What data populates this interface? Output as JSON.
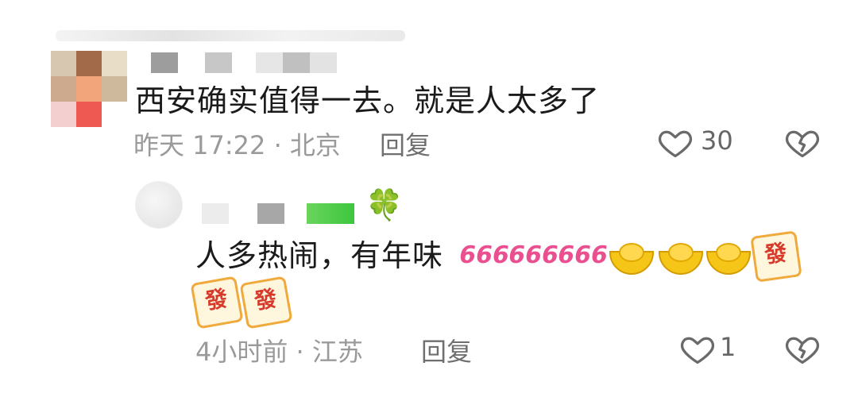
{
  "comments": [
    {
      "text": "西安确实值得一去。就是人太多了",
      "time": "昨天 17:22",
      "location": "北京",
      "reply_label": "回复",
      "likes": "30"
    }
  ],
  "replies": [
    {
      "text": "人多热闹，有年味",
      "emoji_666": "666",
      "mahjong_char": "發",
      "time": "4小时前",
      "location": "江苏",
      "reply_label": "回复",
      "likes": "1",
      "clover": "🍀"
    }
  ],
  "colors": {
    "accent_pink": "#ea4f8f",
    "gold": "#f5c518",
    "clover_green": "#41b347"
  }
}
